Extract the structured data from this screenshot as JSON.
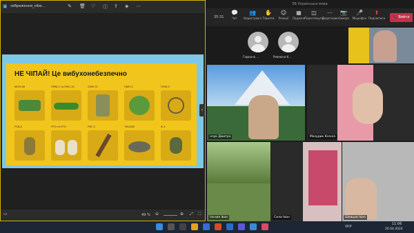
{
  "photos": {
    "title": "зображення_vibe...",
    "slide_title": "НЕ ЧІПАЙ! Це вибухонебезпечно",
    "items_row1": [
      "МОН-50",
      "ПФМ-1 та ПФС-1С",
      "ОЗМ-72",
      "ПМН-2",
      "ПОМ-2"
    ],
    "items_row2": [
      "РГД-5",
      "РГО та РГН",
      "РКГ-3",
      "ТМ-62М",
      "Ф-1"
    ],
    "zoom": "49 %"
  },
  "teams": {
    "window_title": "5Б Українська мова",
    "timer": "35:31",
    "toolbar": [
      "Чат",
      "Користувачі",
      "Підняти",
      "Реакції",
      "Подання",
      "Переглянути",
      "Додатково",
      "Камера",
      "Мікрофон",
      "Поділитися"
    ],
    "leave": "Вийти",
    "participants": [
      {
        "name": "Горюхно ..."
      },
      {
        "name": "Ревякіна К..."
      },
      {
        "name": "нчук Дмитро"
      },
      {
        "name": "Мазурик Ксенія"
      },
      {
        "name": "Ільчик Іван"
      },
      {
        "name": "Сила Іван"
      },
      {
        "name": "Шевцов Іван"
      }
    ]
  },
  "taskbar": {
    "lang": "УКР",
    "time": "11:06",
    "date": "26.04.2024"
  }
}
